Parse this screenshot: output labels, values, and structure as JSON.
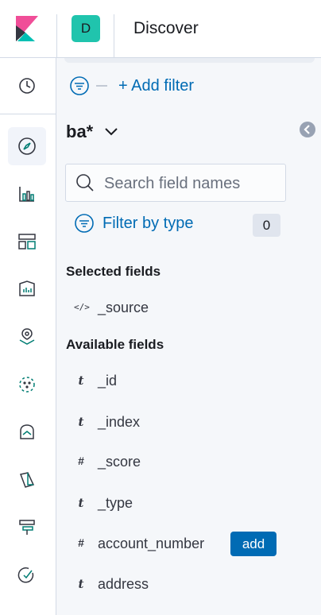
{
  "header": {
    "space_initial": "D",
    "page_title": "Discover"
  },
  "nav": {
    "items": [
      {
        "icon": "clock-icon"
      },
      {
        "icon": "compass-icon",
        "active": true
      },
      {
        "icon": "visualize-icon"
      },
      {
        "icon": "dashboard-icon"
      },
      {
        "icon": "canvas-icon"
      },
      {
        "icon": "maps-icon"
      },
      {
        "icon": "ml-icon"
      },
      {
        "icon": "metrics-icon"
      },
      {
        "icon": "logs-icon"
      },
      {
        "icon": "apm-icon"
      },
      {
        "icon": "uptime-icon"
      }
    ]
  },
  "sidebar": {
    "add_filter_label": "+ Add filter",
    "index_pattern": "ba*",
    "search_placeholder": "Search field names",
    "filter_by_type_label": "Filter by type",
    "filter_count": "0",
    "selected_title": "Selected fields",
    "selected_fields": [
      {
        "type_symbol": "</>",
        "name": "_source"
      }
    ],
    "available_title": "Available fields",
    "available_fields": [
      {
        "type_symbol": "t",
        "name": "_id"
      },
      {
        "type_symbol": "t",
        "name": "_index"
      },
      {
        "type_symbol": "#",
        "name": "_score"
      },
      {
        "type_symbol": "t",
        "name": "_type"
      },
      {
        "type_symbol": "#",
        "name": "account_number",
        "action_label": "add"
      },
      {
        "type_symbol": "t",
        "name": "address"
      }
    ]
  },
  "colors": {
    "accent": "#006bb4",
    "space_avatar": "#20c4ad",
    "nav_icon": "#343741",
    "nav_icon_teal": "#017d73"
  }
}
